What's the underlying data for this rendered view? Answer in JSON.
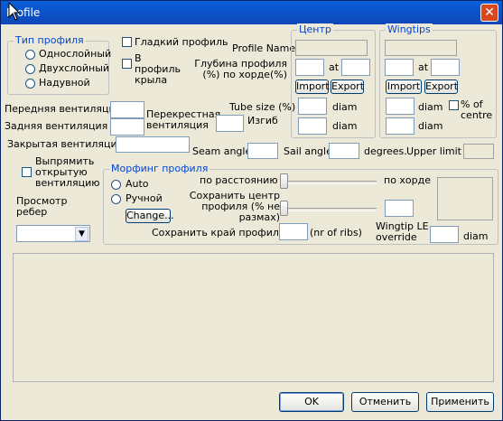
{
  "window": {
    "title": "Profile"
  },
  "profile_type": {
    "title": "Тип профиля",
    "options": [
      "Однослойный",
      "Двухслойный",
      "Надувной"
    ]
  },
  "checks": {
    "smooth_profile": "Гладкий профиль",
    "into_wing_profile": "В профиль крыла"
  },
  "profile_name_label": "Profile Name",
  "depth_label": "Глубина профиля (%) по хорде(%)",
  "center": {
    "title": "Центр",
    "at": "at",
    "import": "Import",
    "export": "Export",
    "diam1": "diam",
    "diam2": "diam"
  },
  "wingtips": {
    "title": "Wingtips",
    "at": "at",
    "import": "Import",
    "export": "Export",
    "diam1": "diam",
    "diam2": "diam",
    "pct_centre": "% of centre"
  },
  "ventilation": {
    "front": "Передняя вентиляция",
    "rear": "Задняя вентиляция",
    "cross": "Перекрестная вентиляция",
    "closed": "Закрытая вентиляция"
  },
  "tube_size": "Tube size (%)",
  "bend": "Изгиб",
  "seam_angle": "Seam angle",
  "sail_angle": "Sail angle",
  "degrees": "degrees.",
  "upper_limit": "Upper limit is",
  "straighten_open_vent": "Выпрямить открытую вентиляцию",
  "rib_view": "Просмотр ребер",
  "morphing": {
    "title": "Морфинг профиля",
    "auto": "Auto",
    "manual": "Ручной",
    "change_button": "Change...",
    "by_distance": "по расстоянию",
    "by_chord": "по хорде",
    "keep_center": "Сохранить центр профиля (% не размах)",
    "keep_edge": "Сохранить край профиля",
    "nr_of_ribs": "(nr of ribs)",
    "wingtip_le_override": "Wingtip LE override",
    "diam": "diam"
  },
  "buttons": {
    "ok": "OK",
    "cancel": "Отменить",
    "apply": "Применить"
  },
  "colors": {
    "accent": "#0046d5",
    "titlebar": "#0a5fd8"
  }
}
